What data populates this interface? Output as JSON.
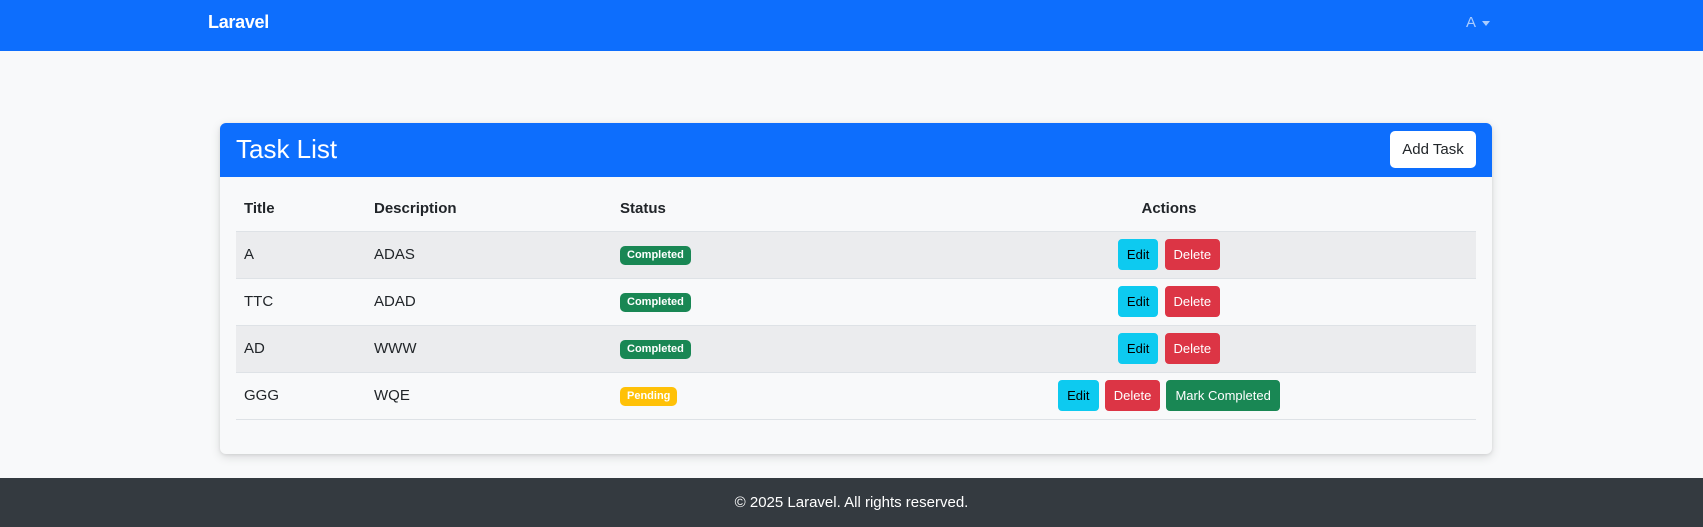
{
  "navbar": {
    "brand": "Laravel",
    "user_label": "A"
  },
  "card": {
    "title": "Task List",
    "add_button_label": "Add Task"
  },
  "table": {
    "headers": {
      "title": "Title",
      "description": "Description",
      "status": "Status",
      "actions": "Actions"
    },
    "rows": [
      {
        "title": "A",
        "description": "ADAS",
        "status": "Completed"
      },
      {
        "title": "TTC",
        "description": "ADAD",
        "status": "Completed"
      },
      {
        "title": "AD",
        "description": "WWW",
        "status": "Completed"
      },
      {
        "title": "GGG",
        "description": "WQE",
        "status": "Pending"
      }
    ],
    "actions": {
      "edit": "Edit",
      "delete": "Delete",
      "mark_completed": "Mark Completed"
    }
  },
  "footer": {
    "text": "© 2025 Laravel. All rights reserved."
  },
  "colors": {
    "primary": "#0d6efd",
    "success": "#198754",
    "warning": "#ffc107",
    "info": "#0dcaf0",
    "danger": "#dc3545",
    "footer_bg": "#343a40"
  }
}
